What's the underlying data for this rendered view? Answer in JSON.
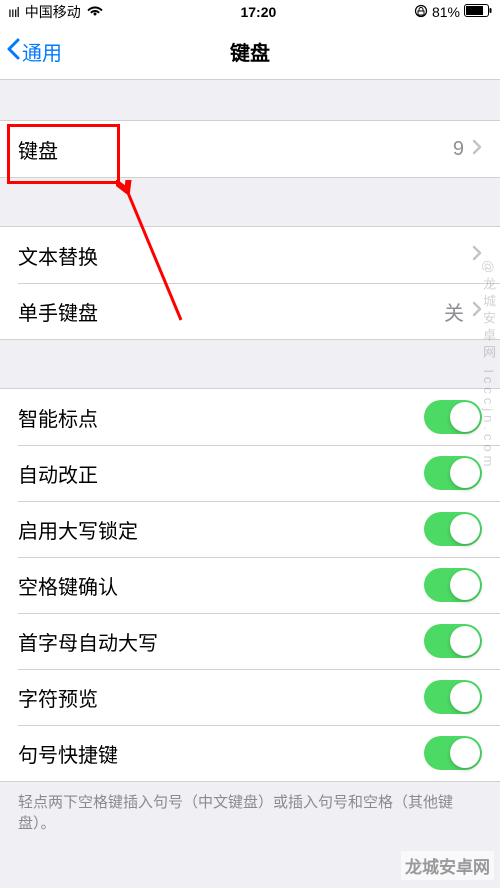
{
  "status": {
    "carrier": "中国移动",
    "time": "17:20",
    "battery": "81%"
  },
  "nav": {
    "back": "通用",
    "title": "键盘"
  },
  "rows": {
    "keyboards": {
      "label": "键盘",
      "value": "9"
    },
    "text_replace": {
      "label": "文本替换"
    },
    "one_handed": {
      "label": "单手键盘",
      "value": "关"
    },
    "t1": "智能标点",
    "t2": "自动改正",
    "t3": "启用大写锁定",
    "t4": "空格键确认",
    "t5": "首字母自动大写",
    "t6": "字符预览",
    "t7": "句号快捷键"
  },
  "footer": "轻点两下空格键插入句号（中文键盘）或插入句号和空格（其他键盘）。",
  "watermark_side": "@龙城安卓网 lcccjn.com",
  "watermark_corner": "龙城安卓网"
}
